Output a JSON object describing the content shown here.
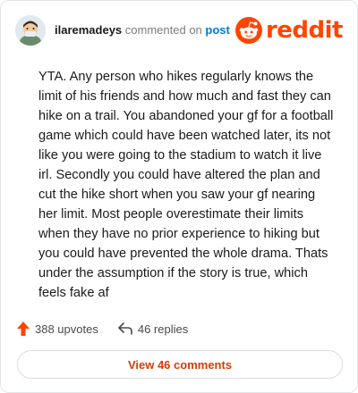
{
  "header": {
    "username": "ilaremadeys",
    "commented_on": "commented on",
    "post_link": "post",
    "logo_text": "reddit"
  },
  "comment": {
    "text": "YTA. Any person who hikes regularly knows the limit of his friends and how much and fast they can hike on a trail. You abandoned your gf for a football game which could have been watched later, its not like you were going to the stadium to watch it live irl. Secondly you could have altered the plan and cut the hike short when you saw your gf nearing her limit. Most people overestimate their limits when they have no prior experience to hiking but you could have prevented the whole drama. Thats under the assumption if the story is true, which feels fake af"
  },
  "actions": {
    "upvotes": "388 upvotes",
    "replies": "46 replies",
    "view_comments": "View 46 comments"
  },
  "colors": {
    "brand": "#ff4500",
    "link": "#0079d3",
    "button_text": "#d93a00"
  },
  "icons": {
    "upvote": "arrow-up-icon",
    "reply": "reply-arrow-icon",
    "logo": "reddit-snoo-icon"
  }
}
